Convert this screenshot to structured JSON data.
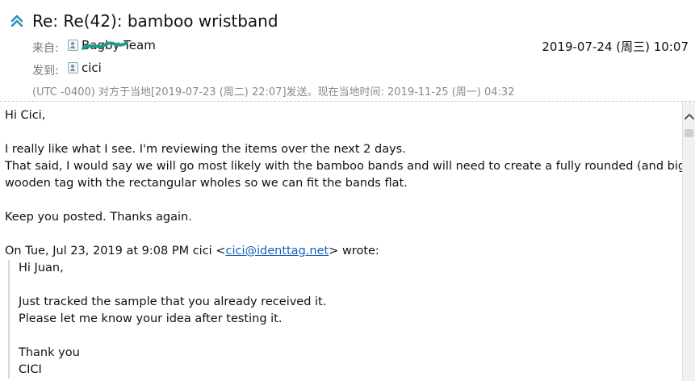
{
  "email": {
    "subject": "Re: Re(42): bamboo wristband",
    "from_label": "来自:",
    "from_name": "Bagby Team",
    "to_label": "发到:",
    "to_name": "cici",
    "date": "2019-07-24 (周三) 10:07",
    "timezone_note": "(UTC -0400) 对方于当地[2019-07-23 (周二) 22:07]发送。现在当地时间: 2019-11-25 (周一) 04:32"
  },
  "message": {
    "greeting": "Hi Cici,",
    "p1_line1": "I really like what I see. I'm reviewing the items over the next 2 days.",
    "p1_line2": "That said, I would say we will go most likely with the bamboo bands and will need to create a fully rounded (and bigger)",
    "p1_line3": "wooden tag with the rectangular wholes so we can fit the bands flat.",
    "p2": "Keep you posted. Thanks again.",
    "quote_intro_prefix": "On Tue, Jul 23, 2019 at 9:08 PM cici <",
    "quote_email": "cici@identtag.net",
    "quote_intro_suffix": "> wrote:",
    "quote": {
      "greeting": "Hi Juan,",
      "line1": "Just tracked the sample that you already received it.",
      "line2": "Please let me know your idea after testing it.",
      "closing": "Thank you",
      "signature": "CICI"
    }
  },
  "colors": {
    "accent": "#2a8fbd",
    "scribble": "#1f9a8e",
    "link": "#1a5fb4"
  },
  "icons": {
    "collapse": "double-chevron-up-icon",
    "contact": "contact-card-icon",
    "scroll_up": "chevron-up-icon"
  }
}
